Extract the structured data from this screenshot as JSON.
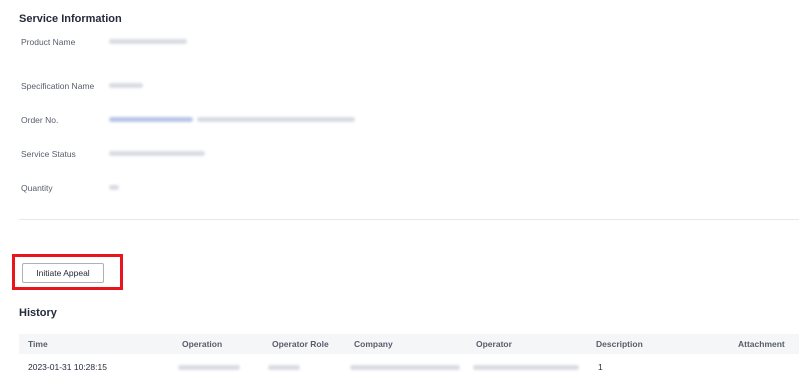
{
  "service_info": {
    "title": "Service Information",
    "rows": [
      {
        "label": "Product Name"
      },
      {
        "label": "Specification Name"
      },
      {
        "label": "Order No."
      },
      {
        "label": "Service Status"
      },
      {
        "label": "Quantity"
      }
    ]
  },
  "actions": {
    "initiate_appeal_label": "Initiate Appeal"
  },
  "history": {
    "title": "History",
    "columns": [
      "Time",
      "Operation",
      "Operator Role",
      "Company",
      "Operator",
      "Description",
      "Attachment"
    ],
    "rows": [
      {
        "time": "2023-01-31 10:28:15",
        "description": "1"
      }
    ]
  },
  "colors": {
    "highlight": "#e8161c",
    "table_header_bg": "#f5f6f7"
  }
}
